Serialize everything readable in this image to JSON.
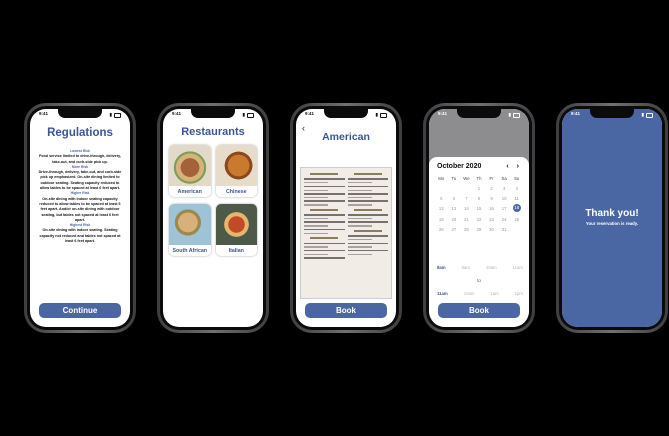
{
  "status_time": "9:41",
  "regulations": {
    "title": "Regulations",
    "lowest_label": "Lowest Risk",
    "lowest_text": "Food service limited to drive-through, delivery, take-out, and curb-side pick up.",
    "more_label": "More Risk",
    "more_text": "Drive-through, delivery, take-out, and curb-side pick up emphasized. On-site dining limited to outdoor seating. Seating capacity reduced to allow tables to be spaced at least 6 feet apart.",
    "higher_label": "Higher Risk",
    "higher_text": "On-site dining with indoor seating capacity reduced to allow tables to be spaced at least 6 feet apart. And/or on-site dining with outdoor seating, but tables not spaced at least 6 feet apart.",
    "highest_label": "Highest Risk",
    "highest_text": "On-site dining with indoor seating. Seating capacity not reduced and tables not spaced at least 6 feet apart.",
    "button": "Continue"
  },
  "restaurants": {
    "title": "Restaurants",
    "items": [
      "American",
      "Chinese",
      "South African",
      "Italian"
    ]
  },
  "menu": {
    "title": "American",
    "button": "Book"
  },
  "calendar": {
    "month": "October 2020",
    "nav": "‹ ›",
    "weekdays": [
      "Mo",
      "Tu",
      "We",
      "Th",
      "Fr",
      "Sa",
      "Su"
    ],
    "days": [
      "",
      "",
      "",
      "1",
      "2",
      "3",
      "4",
      "5",
      "6",
      "7",
      "8",
      "9",
      "10",
      "11",
      "12",
      "13",
      "14",
      "15",
      "16",
      "17",
      "18",
      "19",
      "20",
      "21",
      "22",
      "23",
      "24",
      "25",
      "26",
      "27",
      "28",
      "29",
      "30",
      "31",
      "",
      ""
    ],
    "selected_day": "18",
    "start_times": [
      "8am",
      "9am",
      "10am",
      "11am"
    ],
    "to_label": "to",
    "end_times": [
      "11am",
      "12am",
      "1am",
      "1pm"
    ],
    "button": "Book"
  },
  "thanks": {
    "title": "Thank you!",
    "subtitle": "Your reservation is ready."
  },
  "colors": {
    "accent": "#4a67a3",
    "title": "#3b5694",
    "background": "#000000"
  }
}
